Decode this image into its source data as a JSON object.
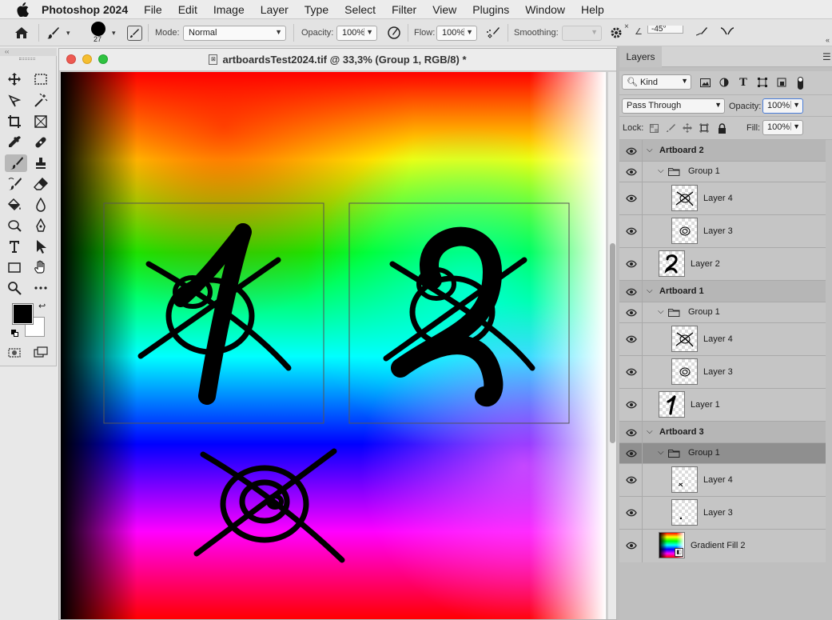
{
  "menubar": {
    "app_name": "Photoshop 2024",
    "items": [
      "File",
      "Edit",
      "Image",
      "Layer",
      "Type",
      "Select",
      "Filter",
      "View",
      "Plugins",
      "Window",
      "Help"
    ]
  },
  "options": {
    "brush_size": "27",
    "mode_label": "Mode:",
    "mode_value": "Normal",
    "opacity_label": "Opacity:",
    "opacity_value": "100%",
    "flow_label": "Flow:",
    "flow_value": "100%",
    "smoothing_label": "Smoothing:",
    "smoothing_value": "",
    "angle_value": "-45°"
  },
  "document": {
    "title": "artboardsTest2024.tif @ 33,3% (Group 1, RGB/8) *"
  },
  "layers_panel": {
    "tab": "Layers",
    "filter_kind": "Kind",
    "blend_mode": "Pass Through",
    "opacity_label": "Opacity:",
    "opacity_value": "100%",
    "lock_label": "Lock:",
    "fill_label": "Fill:",
    "fill_value": "100%",
    "rows": [
      {
        "name": "Artboard 2",
        "kind": "artboard"
      },
      {
        "name": "Group 1",
        "kind": "group"
      },
      {
        "name": "Layer 4",
        "kind": "nested-layer",
        "thumb": "x"
      },
      {
        "name": "Layer 3",
        "kind": "nested-layer",
        "thumb": "spiral"
      },
      {
        "name": "Layer 2",
        "kind": "layer",
        "thumb": "two"
      },
      {
        "name": "Artboard 1",
        "kind": "artboard"
      },
      {
        "name": "Group 1",
        "kind": "group"
      },
      {
        "name": "Layer 4",
        "kind": "nested-layer",
        "thumb": "x"
      },
      {
        "name": "Layer 3",
        "kind": "nested-layer",
        "thumb": "spiral"
      },
      {
        "name": "Layer 1",
        "kind": "layer",
        "thumb": "one"
      },
      {
        "name": "Artboard 3",
        "kind": "artboard"
      },
      {
        "name": "Group 1",
        "kind": "group",
        "selected": true
      },
      {
        "name": "Layer 4",
        "kind": "nested-layer",
        "thumb": "small-x"
      },
      {
        "name": "Layer 3",
        "kind": "nested-layer",
        "thumb": "dot"
      },
      {
        "name": "Gradient Fill 2",
        "kind": "layer",
        "thumb": "gradient"
      }
    ]
  }
}
